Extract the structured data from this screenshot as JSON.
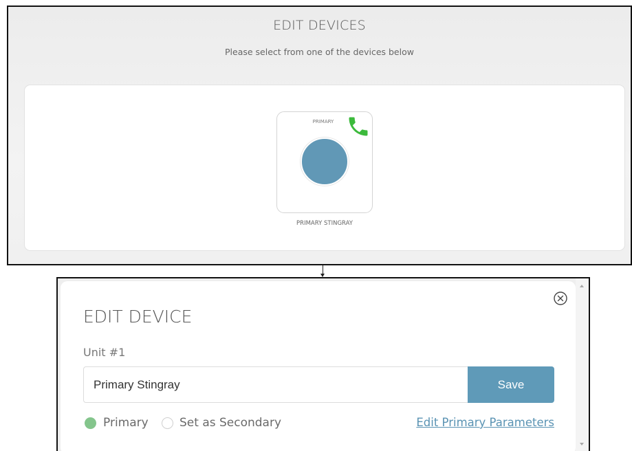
{
  "edit_devices": {
    "title": "EDIT DEVICES",
    "subtitle": "Please select from one of the devices below",
    "device": {
      "tag": "PRIMARY",
      "name": "PRIMARY STINGRAY",
      "status_icon": "phone-icon",
      "status_color": "#3cba3c",
      "avatar_color": "#6198b6"
    }
  },
  "edit_device": {
    "title": "EDIT DEVICE",
    "unit_label": "Unit #1",
    "name_value": "Primary Stingray",
    "save_label": "Save",
    "radio_primary_label": "Primary",
    "radio_secondary_label": "Set as Secondary",
    "selected": "Primary",
    "edit_link": "Edit Primary Parameters",
    "close_icon": "close-circle-icon"
  },
  "colors": {
    "accent": "#5f9ab8",
    "selected_radio": "#84c58c",
    "link": "#5a93b3"
  }
}
